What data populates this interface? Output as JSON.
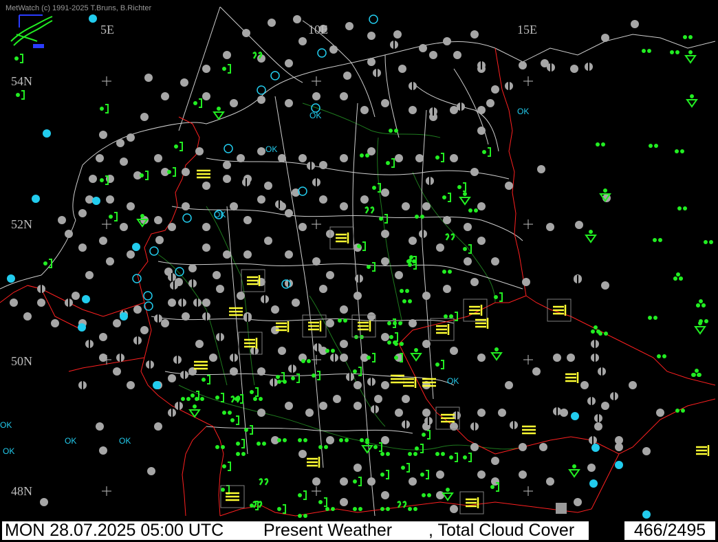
{
  "credit": "MetWatch  (c) 1991-2025 T.Bruns, B.Richter",
  "status": {
    "datetime": "MON 28.07.2025 05:00 UTC",
    "parameter1": "Present Weather",
    "parameter2": ", Total Cloud Cover",
    "counter": "466/2495"
  },
  "grid_labels": {
    "lon": [
      "5E",
      "10E",
      "15E"
    ],
    "lat": [
      "54N",
      "52N",
      "50N",
      "48N"
    ]
  },
  "ok_label": "OK",
  "colors": {
    "background": "#000000",
    "borders": "#ff2020",
    "rivers": "#1e7a1e",
    "coast": "#cfcfcf",
    "cloud": "#a6a6a6",
    "precip": "#22ee22",
    "fog": "#ffff33",
    "clear": "#22ccee"
  }
}
